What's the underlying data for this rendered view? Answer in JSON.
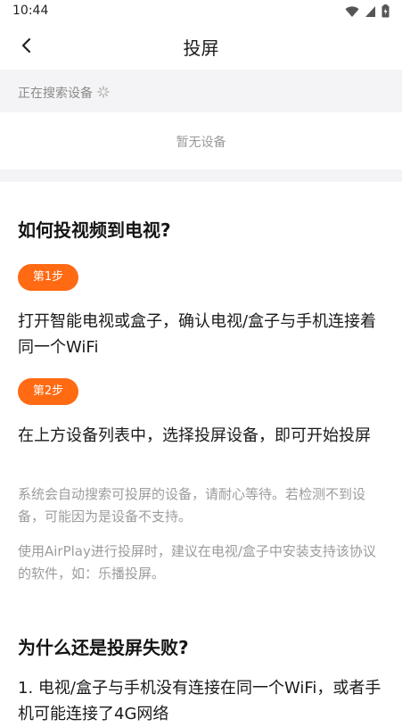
{
  "status_bar": {
    "time": "10:44"
  },
  "nav": {
    "title": "投屏"
  },
  "search": {
    "status": "正在搜索设备"
  },
  "devices": {
    "empty_text": "暂无设备"
  },
  "help": {
    "how_title": "如何投视频到电视?",
    "steps": [
      {
        "badge": "第1步",
        "text": "打开智能电视或盒子，确认电视/盒子与手机连接着同一个WiFi"
      },
      {
        "badge": "第2步",
        "text": "在上方设备列表中，选择投屏设备，即可开始投屏"
      }
    ],
    "notes": [
      "系统会自动搜索可投屏的设备，请耐心等待。若检测不到设备，可能因为是设备不支持。",
      "使用AirPlay进行投屏时，建议在电视/盒子中安装支持该协议的软件，如：乐播投屏。"
    ],
    "why_title": "为什么还是投屏失败?",
    "reasons": [
      "1. 电视/盒子与手机没有连接在同一个WiFi，或者手机可能连接了4G网络"
    ]
  },
  "colors": {
    "accent": "#ff6a13",
    "background_strip": "#f4f4f6"
  },
  "icons": [
    "wifi-icon",
    "signal-icon",
    "battery-icon",
    "back-arrow-icon",
    "spinner-icon"
  ]
}
